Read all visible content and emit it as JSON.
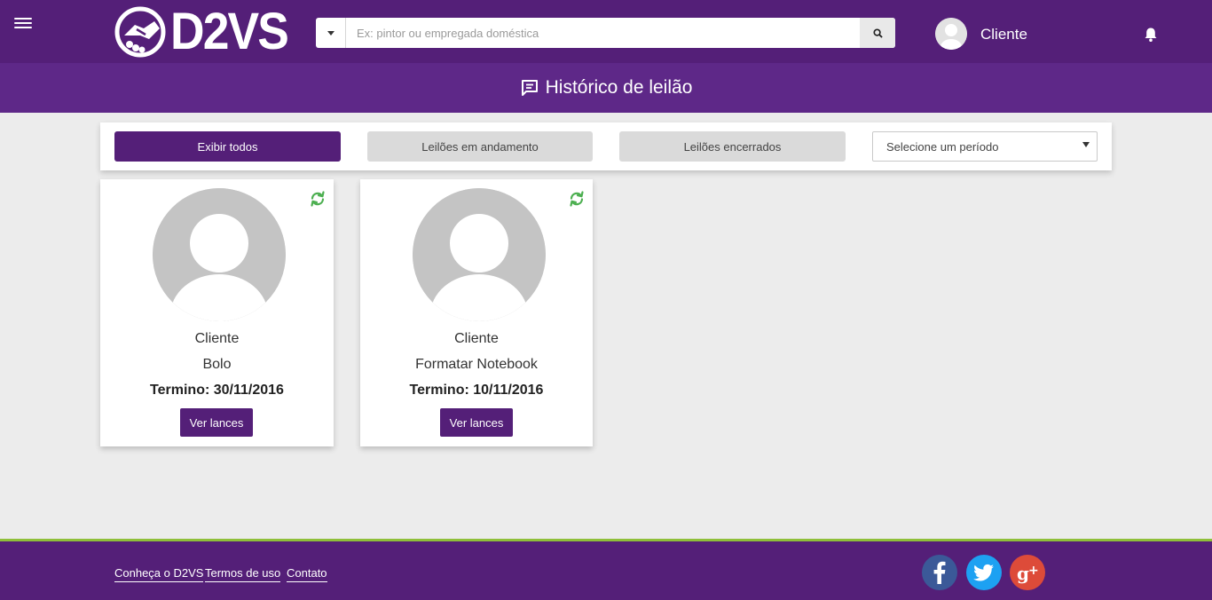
{
  "header": {
    "logo_text": "D2VS",
    "search_placeholder": "Ex: pintor ou empregada doméstica",
    "user_name": "Cliente"
  },
  "page": {
    "title": "Histórico de leilão"
  },
  "filters": {
    "show_all": "Exibir todos",
    "in_progress": "Leilões em andamento",
    "closed": "Leilões encerrados",
    "period_select": "Selecione um período"
  },
  "cards": [
    {
      "client": "Cliente",
      "title": "Bolo",
      "end": "Termino: 30/11/2016",
      "button": "Ver lances"
    },
    {
      "client": "Cliente",
      "title": "Formatar Notebook",
      "end": "Termino: 10/11/2016",
      "button": "Ver lances"
    }
  ],
  "footer": {
    "links": [
      "Conheça o D2VS",
      "Termos de uso",
      "Contato"
    ],
    "social": [
      "facebook-icon",
      "twitter-icon",
      "google-plus-icon"
    ]
  },
  "colors": {
    "primary": "#541f78",
    "title_bar": "#5e2888",
    "accent_green": "#4caf50",
    "footer_border": "#8fbf3a",
    "facebook": "#3b5998",
    "twitter": "#1da1f2",
    "google_plus": "#dd4b39"
  }
}
